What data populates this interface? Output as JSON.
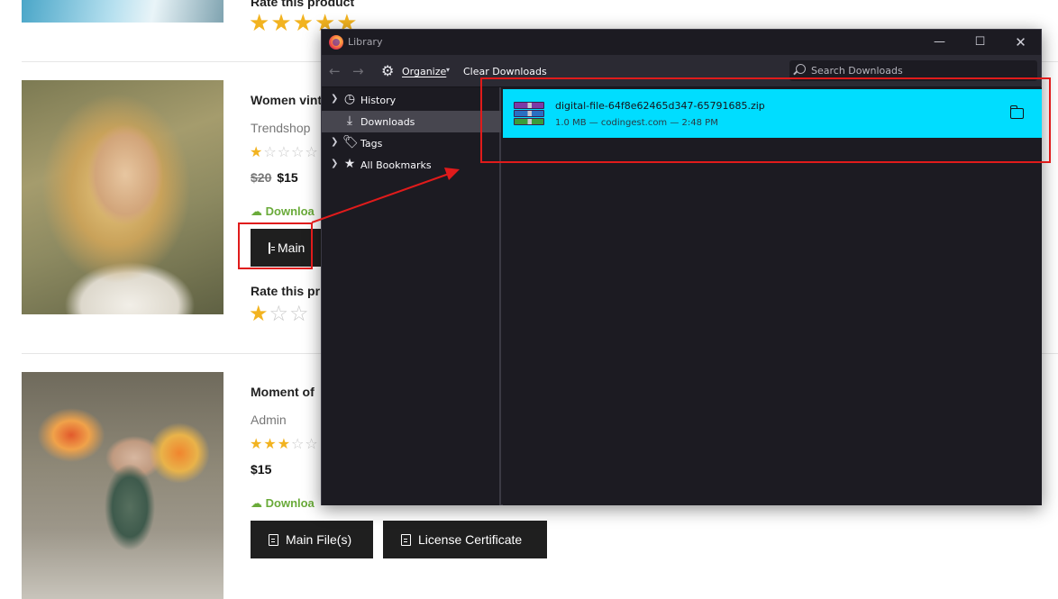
{
  "products": [
    {
      "rate_label": "Rate this product",
      "rating": 5,
      "max_rating": 5
    },
    {
      "title": "Women vint",
      "author": "Trendshop",
      "rating": 1,
      "max_rating": 5,
      "old_price": "$20",
      "price": "$15",
      "download_label": "Downloa",
      "main_button_label": "Main",
      "rate_label": "Rate this pr",
      "user_rating": 1
    },
    {
      "title": "Moment of",
      "author": "Admin",
      "rating": 3,
      "max_rating": 5,
      "price": "$15",
      "download_label": "Downloa",
      "main_button_label": "Main File(s)",
      "license_button_label": "License Certificate"
    }
  ],
  "library": {
    "title": "Library",
    "toolbar": {
      "back_icon": "back-arrow-icon",
      "forward_icon": "forward-arrow-icon",
      "organize_label": "Organize",
      "clear_label": "Clear Downloads",
      "search_placeholder": "Search Downloads"
    },
    "sidebar": [
      {
        "label": "History",
        "icon": "clock-icon",
        "expandable": true,
        "selected": false
      },
      {
        "label": "Downloads",
        "icon": "download-icon",
        "expandable": false,
        "selected": true
      },
      {
        "label": "Tags",
        "icon": "tag-icon",
        "expandable": true,
        "selected": false
      },
      {
        "label": "All Bookmarks",
        "icon": "star-icon",
        "expandable": true,
        "selected": false
      }
    ],
    "downloads": [
      {
        "name": "digital-file-64f8e62465d347-65791685.zip",
        "meta": "1.0 MB — codingest.com — 2:48 PM",
        "icon": "winrar-archive-icon"
      }
    ]
  },
  "colors": {
    "accent_cyan": "#00ddff",
    "star_gold": "#f2b320",
    "download_green": "#6aab3a",
    "annotation_red": "#e01b1b"
  }
}
